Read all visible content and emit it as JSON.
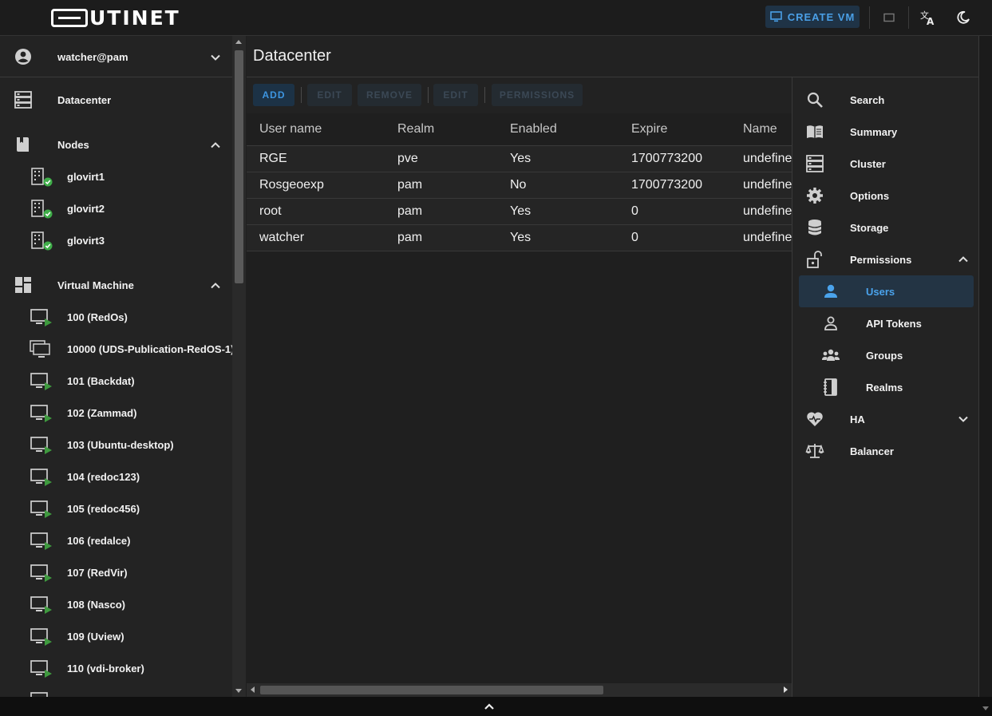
{
  "app": {
    "brand": "UTINET",
    "create_vm_label": "CREATE VM"
  },
  "sidebar": {
    "user": "watcher@pam",
    "datacenter": "Datacenter",
    "nodes_label": "Nodes",
    "nodes": [
      "glovirt1",
      "glovirt2",
      "glovirt3"
    ],
    "vm_label": "Virtual Machine",
    "vms": [
      "100 (RedOs)",
      "10000 (UDS-Publication-RedOS-1)",
      "101 (Backdat)",
      "102 (Zammad)",
      "103 (Ubuntu-desktop)",
      "104 (redoc123)",
      "105 (redoc456)",
      "106 (redalce)",
      "107 (RedVir)",
      "108 (Nasco)",
      "109 (Uview)",
      "110 (vdi-broker)"
    ]
  },
  "main": {
    "title": "Datacenter",
    "toolbar": {
      "add": "ADD",
      "edit": "EDIT",
      "remove": "REMOVE",
      "edit2": "EDIT",
      "permissions": "PERMISSIONS"
    },
    "table": {
      "columns": [
        "User name",
        "Realm",
        "Enabled",
        "Expire",
        "Name"
      ],
      "rows": [
        [
          "RGE",
          "pve",
          "Yes",
          "1700773200",
          "undefined"
        ],
        [
          "Rosgeoexp",
          "pam",
          "No",
          "1700773200",
          "undefined"
        ],
        [
          "root",
          "pam",
          "Yes",
          "0",
          "undefined"
        ],
        [
          "watcher",
          "pam",
          "Yes",
          "0",
          "undefined"
        ]
      ]
    }
  },
  "rightnav": {
    "items": [
      {
        "label": "Search",
        "icon": "search-icon"
      },
      {
        "label": "Summary",
        "icon": "book-icon"
      },
      {
        "label": "Cluster",
        "icon": "server-stack-icon"
      },
      {
        "label": "Options",
        "icon": "gear-icon"
      },
      {
        "label": "Storage",
        "icon": "database-icon"
      },
      {
        "label": "Permissions",
        "icon": "unlock-icon"
      }
    ],
    "permissions_sub": [
      {
        "label": "Users",
        "icon": "person-icon"
      },
      {
        "label": "API Tokens",
        "icon": "person-outline-icon"
      },
      {
        "label": "Groups",
        "icon": "group-icon"
      },
      {
        "label": "Realms",
        "icon": "notebook-icon"
      }
    ],
    "ha": "HA",
    "balancer": "Balancer"
  },
  "colors": {
    "accent": "#3d95e0",
    "selected_bg": "#233444",
    "status_ok": "#3fae49",
    "vm_arrow": "#3f9a3f"
  }
}
